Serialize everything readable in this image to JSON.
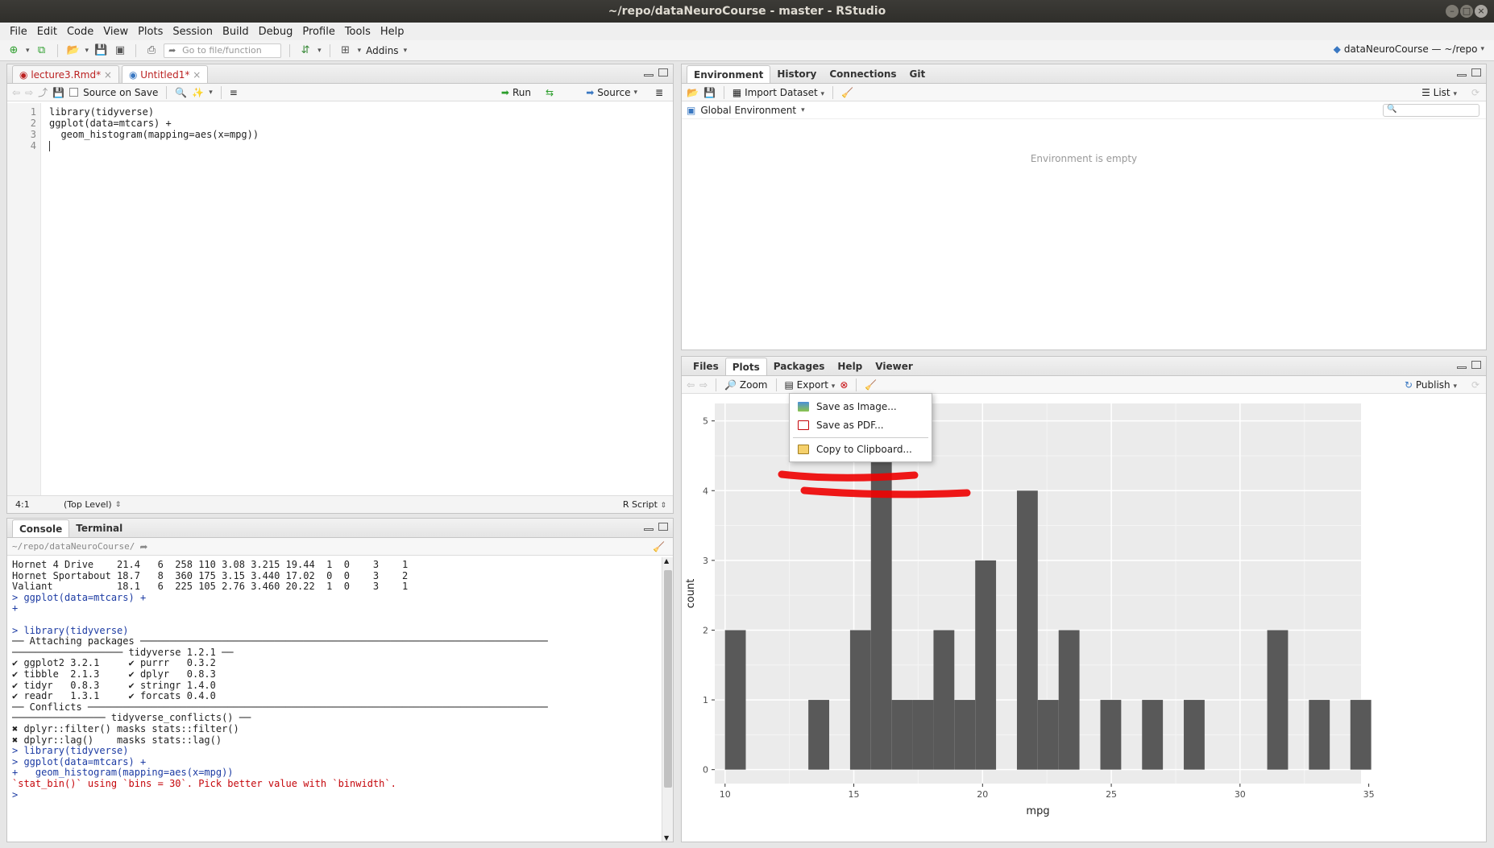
{
  "window": {
    "title": "~/repo/dataNeuroCourse - master - RStudio"
  },
  "menubar": [
    "File",
    "Edit",
    "Code",
    "View",
    "Plots",
    "Session",
    "Build",
    "Debug",
    "Profile",
    "Tools",
    "Help"
  ],
  "toolbar": {
    "goto_placeholder": "Go to file/function",
    "addins": "Addins",
    "project": "dataNeuroCourse — ~/repo"
  },
  "editor": {
    "tabs": [
      {
        "label": "lecture3.Rmd*",
        "active": false
      },
      {
        "label": "Untitled1*",
        "active": true
      }
    ],
    "source_on_save": "Source on Save",
    "run": "Run",
    "source": "Source",
    "lines": [
      {
        "n": "1",
        "code": "library(tidyverse)"
      },
      {
        "n": "2",
        "code": "ggplot(data=mtcars) +"
      },
      {
        "n": "3",
        "code": "  geom_histogram(mapping=aes(x=mpg))"
      },
      {
        "n": "4",
        "code": ""
      }
    ],
    "status": {
      "position": "4:1",
      "scope": "(Top Level)",
      "filetype": "R Script"
    }
  },
  "console": {
    "tabs": [
      "Console",
      "Terminal"
    ],
    "path": "~/repo/dataNeuroCourse/",
    "lines": [
      "Hornet 4 Drive    21.4   6  258 110 3.08 3.215 19.44  1  0    3    1",
      "Hornet Sportabout 18.7   8  360 175 3.15 3.440 17.02  0  0    3    2",
      "Valiant           18.1   6  225 105 2.76 3.460 20.22  1  0    3    1",
      "> ggplot(data=mtcars) +",
      "+ ",
      "",
      "> library(tidyverse)",
      "── Attaching packages ──────────────────────────────────────────────────────────────────────",
      "─────────────────── tidyverse 1.2.1 ──",
      "✔ ggplot2 3.2.1     ✔ purrr   0.3.2",
      "✔ tibble  2.1.3     ✔ dplyr   0.8.3",
      "✔ tidyr   0.8.3     ✔ stringr 1.4.0",
      "✔ readr   1.3.1     ✔ forcats 0.4.0",
      "── Conflicts ───────────────────────────────────────────────────────────────────────────────",
      "──────────────── tidyverse_conflicts() ──",
      "✖ dplyr::filter() masks stats::filter()",
      "✖ dplyr::lag()    masks stats::lag()",
      "> library(tidyverse)",
      "> ggplot(data=mtcars) +",
      "+   geom_histogram(mapping=aes(x=mpg))",
      "`stat_bin()` using `bins = 30`. Pick better value with `binwidth`.",
      "> "
    ]
  },
  "env": {
    "tabs": [
      "Environment",
      "History",
      "Connections",
      "Git"
    ],
    "import": "Import Dataset",
    "list": "List",
    "scope": "Global Environment",
    "empty": "Environment is empty"
  },
  "plots": {
    "tabs": [
      "Files",
      "Plots",
      "Packages",
      "Help",
      "Viewer"
    ],
    "zoom": "Zoom",
    "export": "Export",
    "publish": "Publish",
    "menu": {
      "save_image": "Save as Image...",
      "save_pdf": "Save as PDF...",
      "copy": "Copy to Clipboard..."
    }
  },
  "chart_data": {
    "type": "bar",
    "xlabel": "mpg",
    "ylabel": "count",
    "xlim": [
      9.6,
      34.7
    ],
    "ylim": [
      0,
      5
    ],
    "xticks": [
      10,
      15,
      20,
      25,
      30,
      35
    ],
    "yticks": [
      0,
      1,
      2,
      3,
      4,
      5
    ],
    "bin_width": 0.809,
    "bins": [
      {
        "x": 10.4,
        "count": 2
      },
      {
        "x": 13.64,
        "count": 1
      },
      {
        "x": 15.26,
        "count": 2
      },
      {
        "x": 16.07,
        "count": 5
      },
      {
        "x": 16.88,
        "count": 1
      },
      {
        "x": 17.69,
        "count": 1
      },
      {
        "x": 18.5,
        "count": 2
      },
      {
        "x": 19.31,
        "count": 1
      },
      {
        "x": 20.12,
        "count": 3
      },
      {
        "x": 21.74,
        "count": 4
      },
      {
        "x": 22.55,
        "count": 1
      },
      {
        "x": 23.36,
        "count": 2
      },
      {
        "x": 24.98,
        "count": 1
      },
      {
        "x": 26.6,
        "count": 1
      },
      {
        "x": 28.22,
        "count": 1
      },
      {
        "x": 31.46,
        "count": 2
      },
      {
        "x": 33.08,
        "count": 1
      },
      {
        "x": 34.69,
        "count": 1
      }
    ],
    "bar_color": "#595959",
    "panel_color": "#ebebeb"
  }
}
